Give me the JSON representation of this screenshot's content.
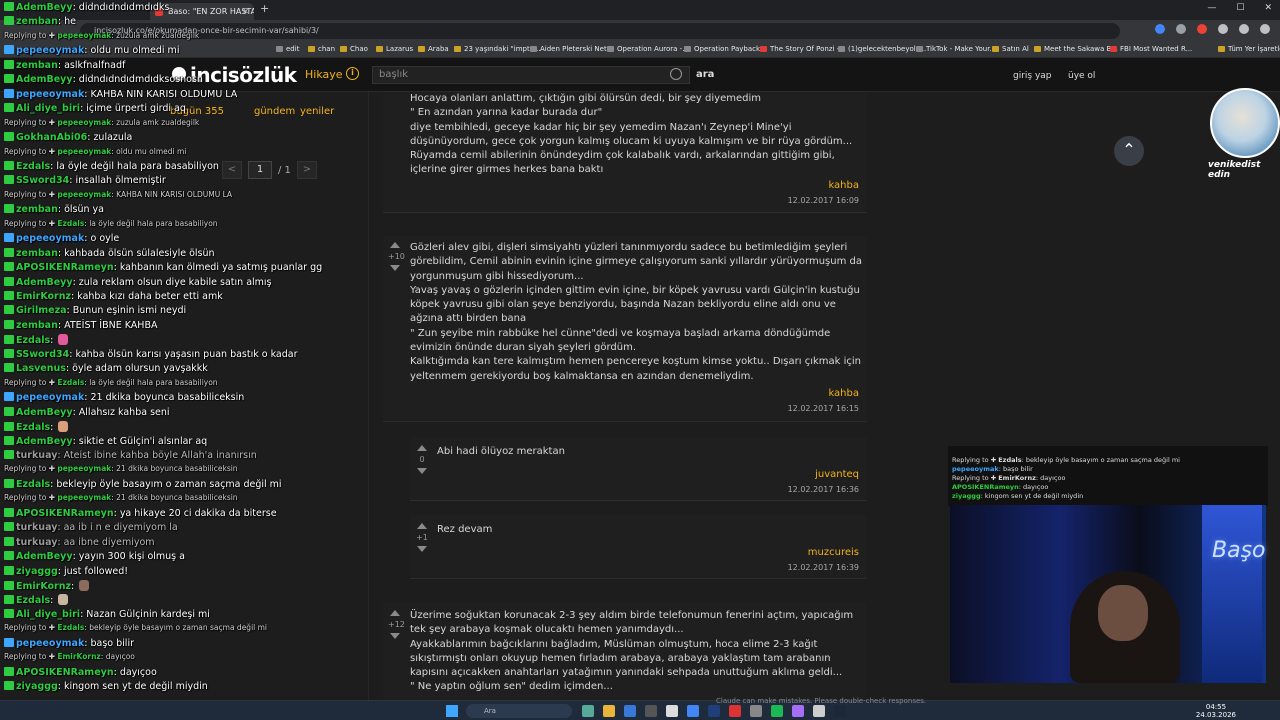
{
  "browser": {
    "tabs": [
      {
        "label": "Baso: \"EN ZOR HASTAM K...",
        "active": true
      },
      {
        "label": "Twitch"
      }
    ],
    "url": "incisozluk.co/e/okumadan-once-bir-secimin-var/sahibi/3/",
    "bookmarks": [
      "edit",
      "chan",
      "Chao",
      "Lazarus",
      "Araba",
      "23 yaşındaki \"impto...",
      "Aiden Pleterski Net...",
      "Operation Aurora -...",
      "Operation Payback...",
      "The Story Of Ponzi -...",
      "(1)gelecektenbeyolc...",
      "TikTok - Make Your...",
      "Satın Al",
      "Meet the Sakawa B...",
      "FBI Most Wanted R...",
      "Tüm Yer İşaretleri"
    ]
  },
  "site": {
    "logo": "incisözlük",
    "hikaye": "Hikaye",
    "search_placeholder": "başlık",
    "search_button": "ara",
    "login": "giriş yap",
    "signup": "üye ol",
    "today": "bugün 355",
    "gundem": "gündem",
    "yeniler": "yeniler",
    "page_current": "1",
    "page_total": "/ 1"
  },
  "entries": [
    {
      "vote": "",
      "text": "Hocaya olanları anlattım, çıktığın gibi ölürsün dedi, bir şey diyemedim\n\" En azından yarına kadar burada dur\"\ndiye tembihledi, geceye kadar hiç bir şey yemedim Nazan'ı Zeynep'i Mine'yi düşünüyordum, gece çok yorgun kalmış olucam ki uyuya kalmışım ve bir rüya gördüm...\nRüyamda cemil abilerinin önündeydim çok kalabalık vardı, arkalarından gittiğim gibi, içlerine girer girmes herkes bana baktı",
      "author": "kahba",
      "date": "12.02.2017 16:09"
    },
    {
      "vote": "+10",
      "text": "Gözleri alev gibi, dişleri simsiyahtı yüzleri tanınmıyordu sadece bu betimlediğim şeyleri görebildim, Cemil abinin evinin içine girmeye çalışıyorum sanki yıllardır yürüyormuşum da yorgunmuşum gibi hissediyorum...\nYavaş yavaş o gözlerin içinden gittim evin içine, bir köpek yavrusu vardı Gülçin'in kustuğu köpek yavrusu gibi olan şeye benziyordu, başında Nazan bekliyordu eline aldı onu ve ağzına attı birden bana\n\" Zun şeyibe min rabbüke hel cünne\"dedi ve koşmaya başladı arkama döndüğümde evimizin önünde duran siyah şeyleri gördüm.\nKalktığımda kan tere kalmıştım hemen pencereye koştum kimse yoktu.. Dışarı çıkmak için yeltenmem gerekiyordu boş kalmaktansa en azından denemeliydim.",
      "author": "kahba",
      "date": "12.02.2017 16:15"
    },
    {
      "vote": "0",
      "text": "Abi hadi ölüyoz meraktan",
      "author": "juvanteq",
      "date": "12.02.2017 16:36"
    },
    {
      "vote": "+1",
      "text": "Rez devam",
      "author": "muzcureis",
      "date": "12.02.2017 16:39"
    },
    {
      "vote": "+12",
      "text": "Üzerime soğuktan korunacak 2-3 şey aldım birde telefonumun fenerini açtım, yapıcağım tek şey arabaya koşmak olucaktı hemen yanımdaydı...\nAyakkablarımın bağcıklarını bağladım, Müslüman olmuştum, hoca elime 2-3 kağıt sıkıştırmıştı onları okuyup hemen fırladım arabaya, arabaya yaklaştım tam arabanın kapısını açıcakken anahtarları yatağımın yanındaki sehpada unuttuğum aklıma geldi...\n\" Ne yaptın oğlum sen\" dedim içimden..."
    }
  ],
  "chat": [
    {
      "user": "AdemBeyy",
      "msg": "didndıdndıdmdıdks",
      "color": "#2ecc40"
    },
    {
      "user": "zemban",
      "msg": "he",
      "color": "#2ecc40"
    },
    {
      "reply_to": "pepeeoymak",
      "reply_msg": "zuzula amk zualdegilk",
      "type": "reply"
    },
    {
      "user": "pepeeoymak",
      "msg": "oldu mu olmedi mi",
      "color": "#3ea6ff"
    },
    {
      "user": "zemban",
      "msg": "aslkfnalfnadf",
      "color": "#2ecc40"
    },
    {
      "user": "AdemBeyy",
      "msg": "didndıdndıdmdıdksosnosn",
      "color": "#2ecc40"
    },
    {
      "user": "pepeeoymak",
      "msg": "KAHBA NIN KARISI OLDUMU LA",
      "color": "#3ea6ff"
    },
    {
      "user": "Ali_diye_biri",
      "msg": "içime ürperti girdi aq",
      "color": "#2ecc40"
    },
    {
      "reply_to": "pepeeoymak",
      "reply_msg": "zuzula amk zualdegilk",
      "type": "reply"
    },
    {
      "user": "GokhanAbi06",
      "msg": "zulazula",
      "color": "#2ecc40"
    },
    {
      "reply_to": "pepeeoymak",
      "reply_msg": "oldu mu olmedi mi",
      "type": "reply"
    },
    {
      "user": "Ezdals",
      "msg": "la öyle değil hala para basabiliyon",
      "color": "#2ecc40"
    },
    {
      "user": "SSword34",
      "msg": "insallah ölmemiştir",
      "color": "#2ecc40"
    },
    {
      "reply_to": "pepeeoymak",
      "reply_msg": "KAHBA NIN KARISI OLDUMU LA",
      "type": "reply"
    },
    {
      "user": "zemban",
      "msg": "ölsün ya",
      "color": "#2ecc40"
    },
    {
      "reply_to": "Ezdals",
      "reply_msg": "la öyle değil hala para basabiliyon",
      "type": "reply"
    },
    {
      "user": "pepeeoymak",
      "msg": "o oyle",
      "color": "#3ea6ff"
    },
    {
      "user": "zemban",
      "msg": "kahbada ölsün sülalesiyle ölsün",
      "color": "#2ecc40"
    },
    {
      "user": "APOSIKENRameyn",
      "msg": "kahbanın kan ölmedi ya satmış puanlar gg",
      "color": "#2ecc40"
    },
    {
      "user": "AdemBeyy",
      "msg": "zula reklam olsun diye kabile satın almış",
      "color": "#2ecc40"
    },
    {
      "user": "EmirKornz",
      "msg": "kahba kızı daha beter etti amk",
      "color": "#2ecc40"
    },
    {
      "user": "Girilmeza",
      "msg": "Bunun eşinin ismi neydi",
      "color": "#2ecc40"
    },
    {
      "user": "zemban",
      "msg": "ATEİST İBNE KAHBA",
      "color": "#2ecc40"
    },
    {
      "user": "Ezdals",
      "msg": "",
      "emote": "#e05a9c",
      "color": "#2ecc40"
    },
    {
      "user": "SSword34",
      "msg": "kahba ölsün karısı yaşasın puan bastık o kadar",
      "color": "#2ecc40"
    },
    {
      "user": "Lasvenus",
      "msg": "öyle adam olursun yavşakkk",
      "color": "#2ecc40"
    },
    {
      "reply_to": "Ezdals",
      "reply_msg": "la öyle değil hala para basabiliyon",
      "type": "reply"
    },
    {
      "user": "pepeeoymak",
      "msg": "21 dkika boyunca basabiliceksin",
      "color": "#3ea6ff"
    },
    {
      "user": "AdemBeyy",
      "msg": "Allahsız kahba seni",
      "color": "#2ecc40"
    },
    {
      "user": "Ezdals",
      "msg": "",
      "emote": "#d9a07a",
      "color": "#2ecc40"
    },
    {
      "user": "AdemBeyy",
      "msg": "siktie et Gülçin'i alsınlar aq",
      "color": "#2ecc40"
    },
    {
      "user": "turkuay",
      "msg": "Ateist ibine kahba böyle Allah'a inanırsın",
      "color": "#9a9a9a",
      "dim": true
    },
    {
      "reply_to": "pepeeoymak",
      "reply_msg": "21 dkika boyunca basabiliceksin",
      "type": "reply"
    },
    {
      "user": "Ezdals",
      "msg": "bekleyip öyle basayım o zaman saçma değil mi",
      "color": "#2ecc40"
    },
    {
      "reply_to": "pepeeoymak",
      "reply_msg": "21 dkika boyunca basabiliceksin",
      "type": "reply"
    },
    {
      "user": "APOSIKENRameyn",
      "msg": "ya hikaye 20 ci dakika da biterse",
      "color": "#2ecc40"
    },
    {
      "user": "turkuay",
      "msg": "aa ib i n e diyemiyom la",
      "color": "#9a9a9a",
      "dim": true
    },
    {
      "user": "turkuay",
      "msg": "aa ibne diyemiyom",
      "color": "#9a9a9a",
      "dim": true
    },
    {
      "user": "AdemBeyy",
      "msg": "yayın 300 kişi olmuş a",
      "color": "#2ecc40"
    },
    {
      "user": "ziyaggg",
      "msg": "just followed!",
      "color": "#2ecc40"
    },
    {
      "user": "EmirKornz",
      "msg": "",
      "emote": "#8a6b5c",
      "color": "#2ecc40"
    },
    {
      "user": "Ezdals",
      "msg": "",
      "emote": "#c8b7a0",
      "color": "#2ecc40"
    },
    {
      "user": "Ali_diye_biri",
      "msg": "Nazan Gülçinin kardeşi mi",
      "color": "#2ecc40"
    },
    {
      "reply_to": "Ezdals",
      "reply_msg": "bekleyip öyle basayım o zaman saçma değil mi",
      "type": "reply"
    },
    {
      "user": "pepeeoymak",
      "msg": "başo bilir",
      "color": "#3ea6ff"
    },
    {
      "reply_to": "EmirKornz",
      "reply_msg": "dayıçoo",
      "type": "reply"
    },
    {
      "user": "APOSIKENRameyn",
      "msg": "dayıçoo",
      "color": "#2ecc40"
    },
    {
      "user": "ziyaggg",
      "msg": "kingom sen yt de değil miydin",
      "color": "#2ecc40"
    }
  ],
  "stream_chat": [
    {
      "reply_to": "Ezdals",
      "reply_msg": "bekleyip öyle basayım o zaman saçma değil mi"
    },
    {
      "user": "pepeeoymak",
      "msg": "başo bilir"
    },
    {
      "reply_to": "EmirKornz",
      "reply_msg": "dayıçoo"
    },
    {
      "user": "APOSIKENRameyn",
      "msg": "dayıçoo"
    },
    {
      "user": "ziyaggg",
      "msg": "kingom sen yt de değil miydin"
    }
  ],
  "overlay": {
    "avatar_caption": "venikedist edin",
    "neon_sign": "Başo"
  },
  "taskbar": {
    "search": "Ara",
    "time": "04:55",
    "date": "24.03.2026",
    "claude_note": "Claude can make mistakes. Please double-check responses."
  }
}
